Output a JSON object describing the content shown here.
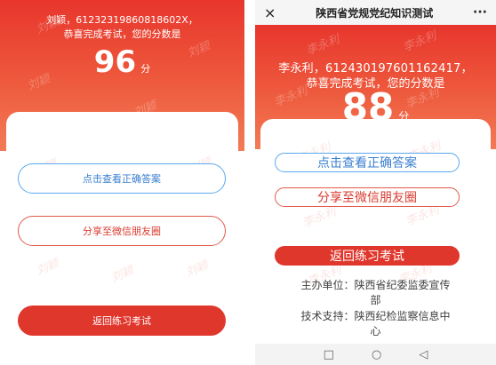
{
  "left": {
    "header_line1": "刘颖，61232319860818602X，",
    "header_line2": "恭喜完成考试，您的分数是",
    "score": "96",
    "score_unit": "分",
    "btn_view_answers": "点击查看正确答案",
    "btn_share": "分享至微信朋友圈",
    "btn_back": "返回练习考试",
    "watermark": "刘颖"
  },
  "right": {
    "topbar": {
      "close_icon": "×",
      "title": "陕西省党规党纪知识测试",
      "more_icon": "···"
    },
    "header_line1": "李永利，612430197601162417，",
    "header_line2": "恭喜完成考试，您的分数是",
    "score": "88",
    "score_unit": "分",
    "btn_view_answers": "点击查看正确答案",
    "btn_share": "分享至微信朋友圈",
    "btn_back": "返回练习考试",
    "organizer_line1": "主办单位：陕西省纪委监委宣传",
    "organizer_line2": "部",
    "tech_line1": "技术支持：陕西纪检监察信息中",
    "tech_line2": "心",
    "watermark": "李永利",
    "navbar": {
      "square_icon": "□",
      "circle_icon": "○",
      "back_icon": "◁"
    }
  },
  "colors": {
    "red": "#e0372d",
    "blue": "#5aa8ee"
  }
}
